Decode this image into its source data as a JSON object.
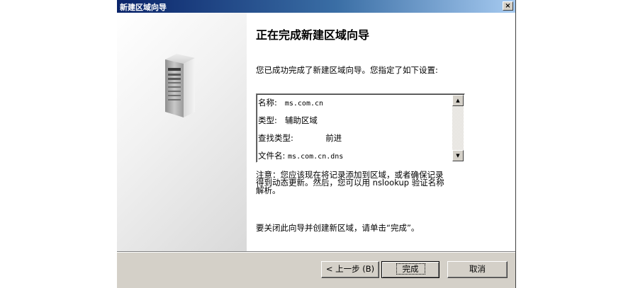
{
  "window": {
    "title": "新建区域向导",
    "close_label": "×"
  },
  "content": {
    "heading": "正在完成新建区域向导",
    "intro": "您已成功完成了新建区域向导。您指定了如下设置:",
    "summary": {
      "name_label": "名称:",
      "name_value": "ms.com.cn",
      "type_label": "类型:",
      "type_value": "辅助区域",
      "lookup_label": "查找类型:",
      "lookup_value": "前进",
      "file_label": "文件名:",
      "file_value": "ms.com.cn.dns"
    },
    "note_line1": "注意：您应该现在将记录添加到区域，或者确保记录",
    "note_line2": "得到动态更新。然后，您可以用 nslookup 验证名称",
    "note_line3": "解析。",
    "finish_instruction": "要关闭此向导并创建新区域，请单击“完成”。"
  },
  "buttons": {
    "back": "< 上一步 (B)",
    "finish": "完成",
    "cancel": "取消"
  },
  "icons": {
    "illustration": "server-icon",
    "scroll_up": "scroll-up-arrow-icon",
    "scroll_down": "scroll-down-arrow-icon"
  }
}
